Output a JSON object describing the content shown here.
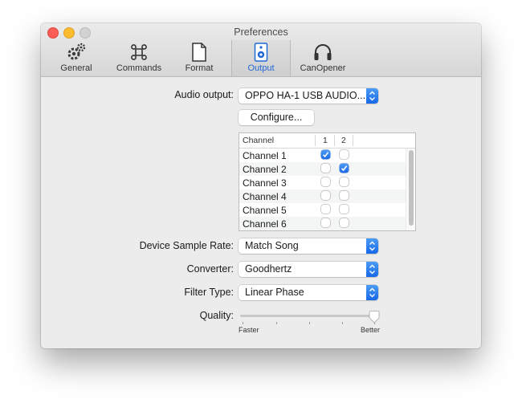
{
  "window": {
    "title": "Preferences"
  },
  "toolbar": {
    "items": [
      {
        "label": "General",
        "icon": "gears-icon"
      },
      {
        "label": "Commands",
        "icon": "command-key-icon"
      },
      {
        "label": "Format",
        "icon": "document-icon"
      },
      {
        "label": "Output",
        "icon": "speaker-icon",
        "selected": true
      },
      {
        "label": "CanOpener",
        "icon": "headphones-icon"
      }
    ]
  },
  "audio_output": {
    "label": "Audio output:",
    "value": "OPPO HA-1 USB AUDIO..."
  },
  "configure_button": {
    "label": "Configure..."
  },
  "channel_table": {
    "headers": [
      "Channel",
      "1",
      "2"
    ],
    "rows": [
      {
        "name": "Channel 1",
        "c1": true,
        "c2": false
      },
      {
        "name": "Channel 2",
        "c1": false,
        "c2": true
      },
      {
        "name": "Channel 3",
        "c1": false,
        "c2": false
      },
      {
        "name": "Channel 4",
        "c1": false,
        "c2": false
      },
      {
        "name": "Channel 5",
        "c1": false,
        "c2": false
      },
      {
        "name": "Channel 6",
        "c1": false,
        "c2": false
      }
    ]
  },
  "sample_rate": {
    "label": "Device Sample Rate:",
    "value": "Match Song"
  },
  "converter": {
    "label": "Converter:",
    "value": "Goodhertz"
  },
  "filter_type": {
    "label": "Filter Type:",
    "value": "Linear Phase"
  },
  "quality": {
    "label": "Quality:",
    "min_label": "Faster",
    "max_label": "Better",
    "value": 1.0
  },
  "colors": {
    "accent": "#1a6ae9",
    "selected_tab_text": "#2169d6"
  }
}
